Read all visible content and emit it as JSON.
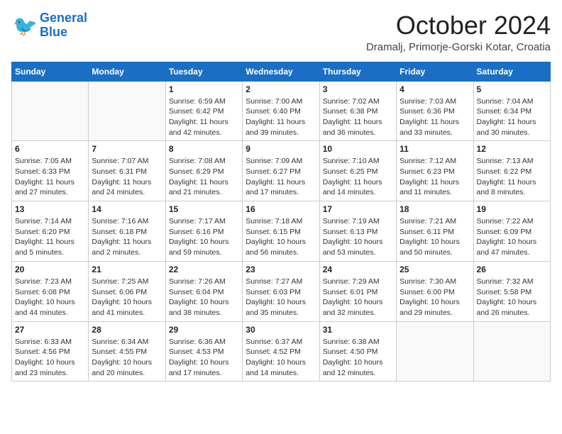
{
  "header": {
    "logo_line1": "General",
    "logo_line2": "Blue",
    "month_year": "October 2024",
    "location": "Dramalj, Primorje-Gorski Kotar, Croatia"
  },
  "weekdays": [
    "Sunday",
    "Monday",
    "Tuesday",
    "Wednesday",
    "Thursday",
    "Friday",
    "Saturday"
  ],
  "weeks": [
    [
      {
        "day": "",
        "sunrise": "",
        "sunset": "",
        "daylight": ""
      },
      {
        "day": "",
        "sunrise": "",
        "sunset": "",
        "daylight": ""
      },
      {
        "day": "1",
        "sunrise": "Sunrise: 6:59 AM",
        "sunset": "Sunset: 6:42 PM",
        "daylight": "Daylight: 11 hours and 42 minutes."
      },
      {
        "day": "2",
        "sunrise": "Sunrise: 7:00 AM",
        "sunset": "Sunset: 6:40 PM",
        "daylight": "Daylight: 11 hours and 39 minutes."
      },
      {
        "day": "3",
        "sunrise": "Sunrise: 7:02 AM",
        "sunset": "Sunset: 6:38 PM",
        "daylight": "Daylight: 11 hours and 36 minutes."
      },
      {
        "day": "4",
        "sunrise": "Sunrise: 7:03 AM",
        "sunset": "Sunset: 6:36 PM",
        "daylight": "Daylight: 11 hours and 33 minutes."
      },
      {
        "day": "5",
        "sunrise": "Sunrise: 7:04 AM",
        "sunset": "Sunset: 6:34 PM",
        "daylight": "Daylight: 11 hours and 30 minutes."
      }
    ],
    [
      {
        "day": "6",
        "sunrise": "Sunrise: 7:05 AM",
        "sunset": "Sunset: 6:33 PM",
        "daylight": "Daylight: 11 hours and 27 minutes."
      },
      {
        "day": "7",
        "sunrise": "Sunrise: 7:07 AM",
        "sunset": "Sunset: 6:31 PM",
        "daylight": "Daylight: 11 hours and 24 minutes."
      },
      {
        "day": "8",
        "sunrise": "Sunrise: 7:08 AM",
        "sunset": "Sunset: 6:29 PM",
        "daylight": "Daylight: 11 hours and 21 minutes."
      },
      {
        "day": "9",
        "sunrise": "Sunrise: 7:09 AM",
        "sunset": "Sunset: 6:27 PM",
        "daylight": "Daylight: 11 hours and 17 minutes."
      },
      {
        "day": "10",
        "sunrise": "Sunrise: 7:10 AM",
        "sunset": "Sunset: 6:25 PM",
        "daylight": "Daylight: 11 hours and 14 minutes."
      },
      {
        "day": "11",
        "sunrise": "Sunrise: 7:12 AM",
        "sunset": "Sunset: 6:23 PM",
        "daylight": "Daylight: 11 hours and 11 minutes."
      },
      {
        "day": "12",
        "sunrise": "Sunrise: 7:13 AM",
        "sunset": "Sunset: 6:22 PM",
        "daylight": "Daylight: 11 hours and 8 minutes."
      }
    ],
    [
      {
        "day": "13",
        "sunrise": "Sunrise: 7:14 AM",
        "sunset": "Sunset: 6:20 PM",
        "daylight": "Daylight: 11 hours and 5 minutes."
      },
      {
        "day": "14",
        "sunrise": "Sunrise: 7:16 AM",
        "sunset": "Sunset: 6:18 PM",
        "daylight": "Daylight: 11 hours and 2 minutes."
      },
      {
        "day": "15",
        "sunrise": "Sunrise: 7:17 AM",
        "sunset": "Sunset: 6:16 PM",
        "daylight": "Daylight: 10 hours and 59 minutes."
      },
      {
        "day": "16",
        "sunrise": "Sunrise: 7:18 AM",
        "sunset": "Sunset: 6:15 PM",
        "daylight": "Daylight: 10 hours and 56 minutes."
      },
      {
        "day": "17",
        "sunrise": "Sunrise: 7:19 AM",
        "sunset": "Sunset: 6:13 PM",
        "daylight": "Daylight: 10 hours and 53 minutes."
      },
      {
        "day": "18",
        "sunrise": "Sunrise: 7:21 AM",
        "sunset": "Sunset: 6:11 PM",
        "daylight": "Daylight: 10 hours and 50 minutes."
      },
      {
        "day": "19",
        "sunrise": "Sunrise: 7:22 AM",
        "sunset": "Sunset: 6:09 PM",
        "daylight": "Daylight: 10 hours and 47 minutes."
      }
    ],
    [
      {
        "day": "20",
        "sunrise": "Sunrise: 7:23 AM",
        "sunset": "Sunset: 6:08 PM",
        "daylight": "Daylight: 10 hours and 44 minutes."
      },
      {
        "day": "21",
        "sunrise": "Sunrise: 7:25 AM",
        "sunset": "Sunset: 6:06 PM",
        "daylight": "Daylight: 10 hours and 41 minutes."
      },
      {
        "day": "22",
        "sunrise": "Sunrise: 7:26 AM",
        "sunset": "Sunset: 6:04 PM",
        "daylight": "Daylight: 10 hours and 38 minutes."
      },
      {
        "day": "23",
        "sunrise": "Sunrise: 7:27 AM",
        "sunset": "Sunset: 6:03 PM",
        "daylight": "Daylight: 10 hours and 35 minutes."
      },
      {
        "day": "24",
        "sunrise": "Sunrise: 7:29 AM",
        "sunset": "Sunset: 6:01 PM",
        "daylight": "Daylight: 10 hours and 32 minutes."
      },
      {
        "day": "25",
        "sunrise": "Sunrise: 7:30 AM",
        "sunset": "Sunset: 6:00 PM",
        "daylight": "Daylight: 10 hours and 29 minutes."
      },
      {
        "day": "26",
        "sunrise": "Sunrise: 7:32 AM",
        "sunset": "Sunset: 5:58 PM",
        "daylight": "Daylight: 10 hours and 26 minutes."
      }
    ],
    [
      {
        "day": "27",
        "sunrise": "Sunrise: 6:33 AM",
        "sunset": "Sunset: 4:56 PM",
        "daylight": "Daylight: 10 hours and 23 minutes."
      },
      {
        "day": "28",
        "sunrise": "Sunrise: 6:34 AM",
        "sunset": "Sunset: 4:55 PM",
        "daylight": "Daylight: 10 hours and 20 minutes."
      },
      {
        "day": "29",
        "sunrise": "Sunrise: 6:36 AM",
        "sunset": "Sunset: 4:53 PM",
        "daylight": "Daylight: 10 hours and 17 minutes."
      },
      {
        "day": "30",
        "sunrise": "Sunrise: 6:37 AM",
        "sunset": "Sunset: 4:52 PM",
        "daylight": "Daylight: 10 hours and 14 minutes."
      },
      {
        "day": "31",
        "sunrise": "Sunrise: 6:38 AM",
        "sunset": "Sunset: 4:50 PM",
        "daylight": "Daylight: 10 hours and 12 minutes."
      },
      {
        "day": "",
        "sunrise": "",
        "sunset": "",
        "daylight": ""
      },
      {
        "day": "",
        "sunrise": "",
        "sunset": "",
        "daylight": ""
      }
    ]
  ]
}
